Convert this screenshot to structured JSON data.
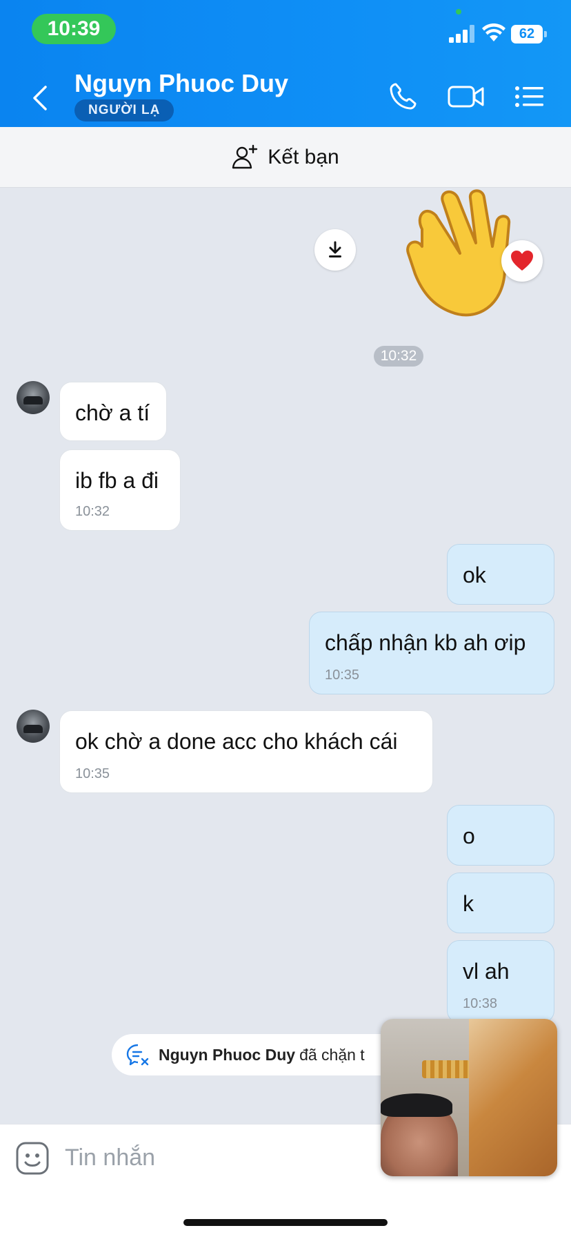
{
  "status_bar": {
    "time": "10:39",
    "battery": "62"
  },
  "header": {
    "contact_name": "Nguyn Phuoc Duy",
    "badge": "NGƯỜI LẠ"
  },
  "add_friend": {
    "label": "Kết bạn"
  },
  "chat": {
    "time_separator": "10:32",
    "messages": [
      {
        "direction": "in",
        "text": "chờ a tí",
        "time": ""
      },
      {
        "direction": "in",
        "text": "ib fb a đi",
        "time": "10:32"
      },
      {
        "direction": "out",
        "text": "ok",
        "time": ""
      },
      {
        "direction": "out",
        "text": "chấp nhận kb ah ơip",
        "time": "10:35"
      },
      {
        "direction": "in",
        "text": "ok chờ a done acc cho khách cái",
        "time": "10:35"
      },
      {
        "direction": "out",
        "text": "o",
        "time": ""
      },
      {
        "direction": "out",
        "text": "k",
        "time": ""
      },
      {
        "direction": "out",
        "text": "vl ah",
        "time": "10:38"
      }
    ]
  },
  "block_notice": {
    "name": "Nguyn Phuoc Duy",
    "text": "đã chặn t"
  },
  "composer": {
    "placeholder": "Tin nhắn"
  },
  "colors": {
    "header_blue": "#0f8ff6",
    "out_bubble": "#d6ecfb",
    "in_bubble": "#ffffff"
  }
}
